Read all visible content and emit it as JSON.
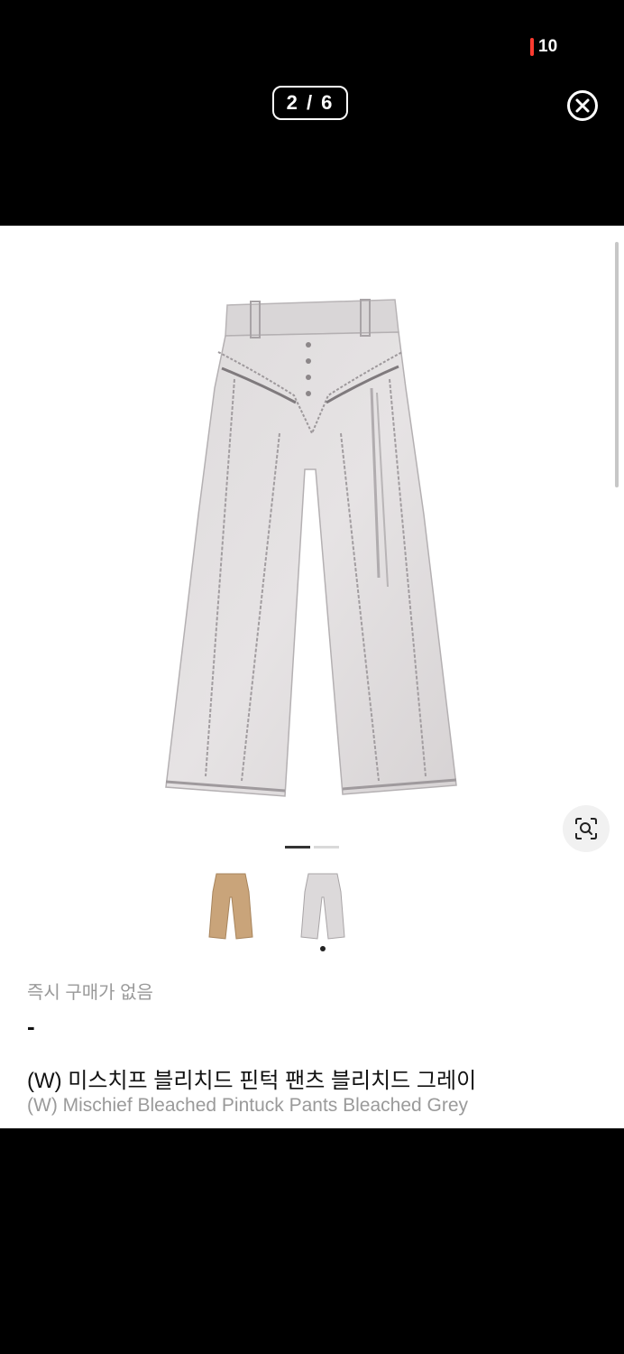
{
  "status_bar": {
    "battery_level": "10",
    "battery_color": "#ff3b30"
  },
  "viewer": {
    "counter": "2 / 6",
    "close_icon": "close-circle-icon"
  },
  "gallery": {
    "active_page": 1,
    "page_count": 2,
    "lens_icon": "visual-search-icon",
    "thumbnails": [
      {
        "color": "beige",
        "selected": false
      },
      {
        "color": "bleached-grey",
        "selected": true
      }
    ]
  },
  "product": {
    "availability": "즉시 구매가 없음",
    "price": "-",
    "name_ko": "(W) 미스치프 블리치드 핀턱 팬츠 블리치드 그레이",
    "name_en": "(W) Mischief Bleached Pintuck Pants Bleached Grey"
  }
}
